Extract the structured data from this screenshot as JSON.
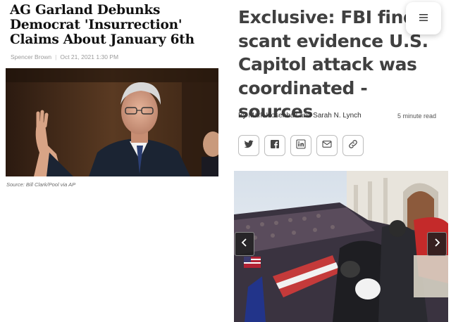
{
  "left_article": {
    "title": "AG Garland Debunks Democrat 'Insurrection' Claims About January 6th",
    "author": "Spencer Brown",
    "timestamp": "Oct 21, 2021 1:30 PM",
    "photo_caption": "Source: Bill Clark/Pool via AP"
  },
  "right_article": {
    "title": "Exclusive: FBI finds scant evidence U.S. Capitol attack was coordinated - sources",
    "byline": "By Mark Hosenball and Sarah N. Lynch",
    "read_time": "5 minute read",
    "share_icons": [
      "twitter-icon",
      "facebook-icon",
      "linkedin-icon",
      "email-icon",
      "link-icon"
    ],
    "menu_icon": "hamburger-menu-icon",
    "carousel_icons": [
      "chevron-left-icon",
      "chevron-right-icon"
    ]
  },
  "colors": {
    "left_title": "#111111",
    "right_title": "#404040",
    "muted_text": "#9a9a9a",
    "button_border": "#bdbdbd"
  }
}
